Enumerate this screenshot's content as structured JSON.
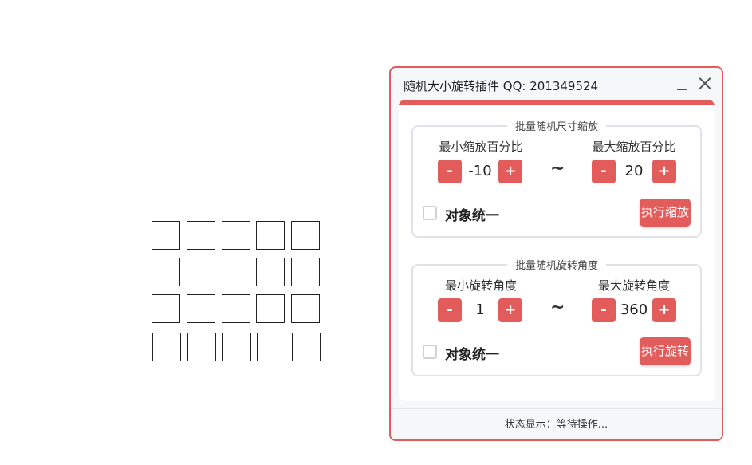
{
  "panel": {
    "title": "随机大小旋转插件  QQ: 201349524",
    "minimize_icon": "minimize-icon",
    "close_icon": "close-icon",
    "accent_color": "#e25c5c"
  },
  "scale_group": {
    "legend": "批量随机尺寸缩放",
    "min_label": "最小缩放百分比",
    "min_value": "-10",
    "max_label": "最大缩放百分比",
    "max_value": "20",
    "separator": "~",
    "uniform_label": "对象统一",
    "uniform_checked": false,
    "execute_label": "执行缩放"
  },
  "rotate_group": {
    "legend": "批量随机旋转角度",
    "min_label": "最小旋转角度",
    "min_value": "1",
    "max_label": "最大旋转角度",
    "max_value": "360",
    "separator": "~",
    "uniform_label": "对象统一",
    "uniform_checked": false,
    "execute_label": "执行旋转"
  },
  "stepper": {
    "minus": "-",
    "plus": "+"
  },
  "status": {
    "text": "状态显示：等待操作..."
  },
  "canvas": {
    "rows": 4,
    "cols": 5
  }
}
